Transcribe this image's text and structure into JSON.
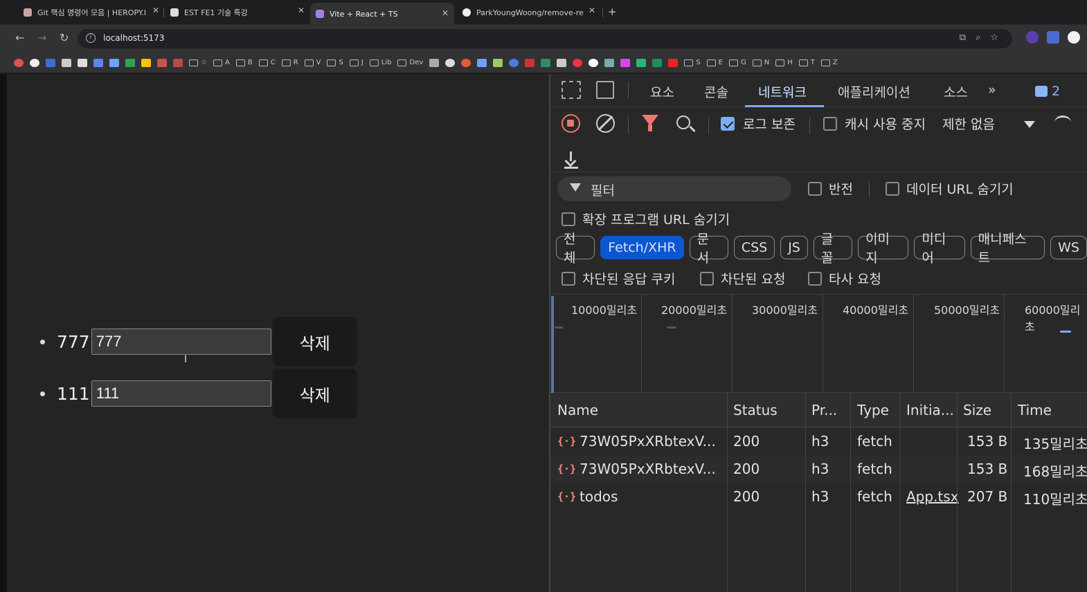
{
  "browser": {
    "tabs": [
      {
        "title": "Git 핵심 명령어 모음 | HEROPY.I",
        "close": "✕"
      },
      {
        "title": "EST FE1 기술 특강",
        "close": "✕"
      },
      {
        "title": "Vite + React + TS",
        "close": "✕"
      },
      {
        "title": "ParkYoungWoong/remove-re",
        "close": "✕"
      }
    ],
    "new_tab": "+",
    "url": "localhost:5173",
    "nav": {
      "back": "←",
      "forward": "→",
      "reload": "↻"
    },
    "bookmarks": [
      "☆",
      "A",
      "B",
      "C",
      "R",
      "V",
      "S",
      "J",
      "Lib",
      "Dev",
      "S",
      "E",
      "G",
      "N",
      "H",
      "T",
      "Z"
    ]
  },
  "page": {
    "todos": [
      {
        "text": "777",
        "input_value": "777",
        "delete_label": "삭제"
      },
      {
        "text": "111",
        "input_value": "111",
        "delete_label": "삭제"
      }
    ]
  },
  "devtools": {
    "tabs": [
      "요소",
      "콘솔",
      "네트워크",
      "애플리케이션",
      "소스"
    ],
    "more": "»",
    "issues_count": "2",
    "toolbar": {
      "preserve_log": "로그 보존",
      "preserve_log_checked": true,
      "disable_cache": "캐시 사용 중지",
      "throttling": "제한 없음"
    },
    "filter": {
      "placeholder": "필터",
      "invert": "반전",
      "hide_data_urls": "데이터 URL 숨기기",
      "hide_extension_urls": "확장 프로그램 URL 숨기기"
    },
    "type_chips": [
      "전체",
      "Fetch/XHR",
      "문서",
      "CSS",
      "JS",
      "글꼴",
      "이미지",
      "미디어",
      "매니페스트",
      "WS"
    ],
    "active_chip": "Fetch/XHR",
    "more_filters": {
      "blocked_cookies": "차단된 응답 쿠키",
      "blocked_requests": "차단된 요청",
      "third_party": "타사 요청"
    },
    "timeline_labels": [
      "10000밀리초",
      "20000밀리초",
      "30000밀리초",
      "40000밀리초",
      "50000밀리초",
      "60000밀리초"
    ],
    "columns": [
      "Name",
      "Status",
      "Pr...",
      "Type",
      "Initia...",
      "Size",
      "Time"
    ],
    "rows": [
      {
        "icon": "{·}",
        "name": "73W05PxXRbtexV...",
        "status": "200",
        "protocol": "h3",
        "type": "fetch",
        "initiator": "",
        "size": "153 B",
        "time": "135밀리초"
      },
      {
        "icon": "{·}",
        "name": "73W05PxXRbtexV...",
        "status": "200",
        "protocol": "h3",
        "type": "fetch",
        "initiator": "",
        "size": "153 B",
        "time": "168밀리초"
      },
      {
        "icon": "{·}",
        "name": "todos",
        "status": "200",
        "protocol": "h3",
        "type": "fetch",
        "initiator": "App.tsx",
        "size": "207 B",
        "time": "110밀리초"
      }
    ],
    "colors": {
      "accent": "#7cacf8",
      "record": "#f2766b",
      "chip_active": "#0b57d0"
    }
  }
}
